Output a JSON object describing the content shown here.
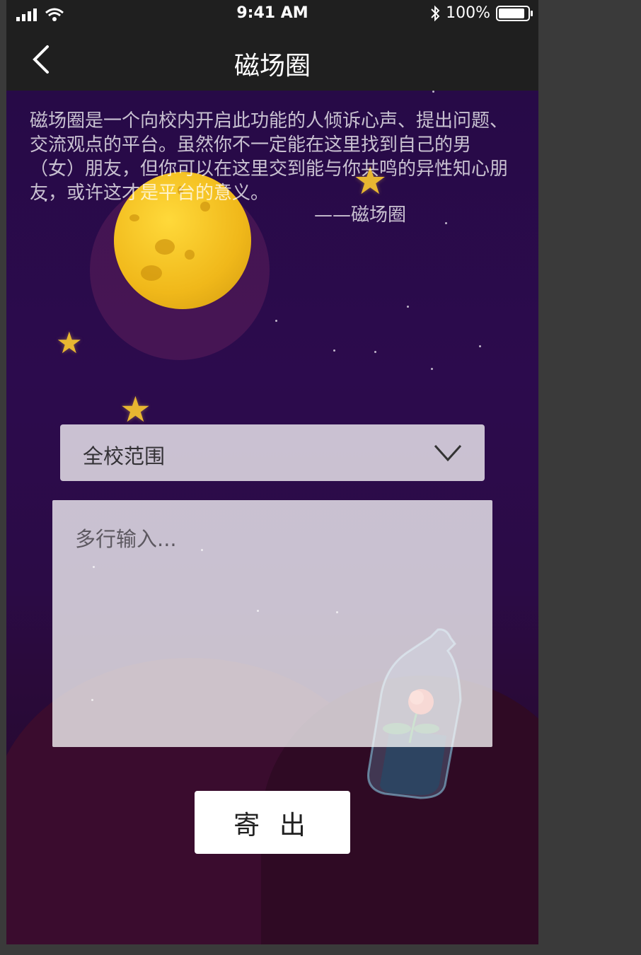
{
  "status_bar": {
    "time": "9:41 AM",
    "battery_text": "100%",
    "battery_level": 1.0,
    "icons": [
      "signal-icon",
      "wifi-icon",
      "bluetooth-icon",
      "battery-icon"
    ]
  },
  "nav": {
    "title": "磁场圈",
    "back_icon": "chevron-left-icon"
  },
  "intro": {
    "text": "磁场圈是一个向校内开启此功能的人倾诉心声、提出问题、交流观点的平台。虽然你不一定能在这里找到自己的男（女）朋友，但你可以在这里交到能与你共鸣的异性知心朋友，或许这才是平台的意义。",
    "signature": "——磁场圈"
  },
  "scope_select": {
    "selected": "全校范围",
    "icon": "chevron-down-icon"
  },
  "message": {
    "placeholder": "多行输入..."
  },
  "send_button": {
    "label": "寄 出"
  },
  "colors": {
    "background": "#2a0a45",
    "bar": "#1f1f1f",
    "moon": "#f0b81a",
    "star": "#e8b631",
    "button": "#ffffff"
  }
}
